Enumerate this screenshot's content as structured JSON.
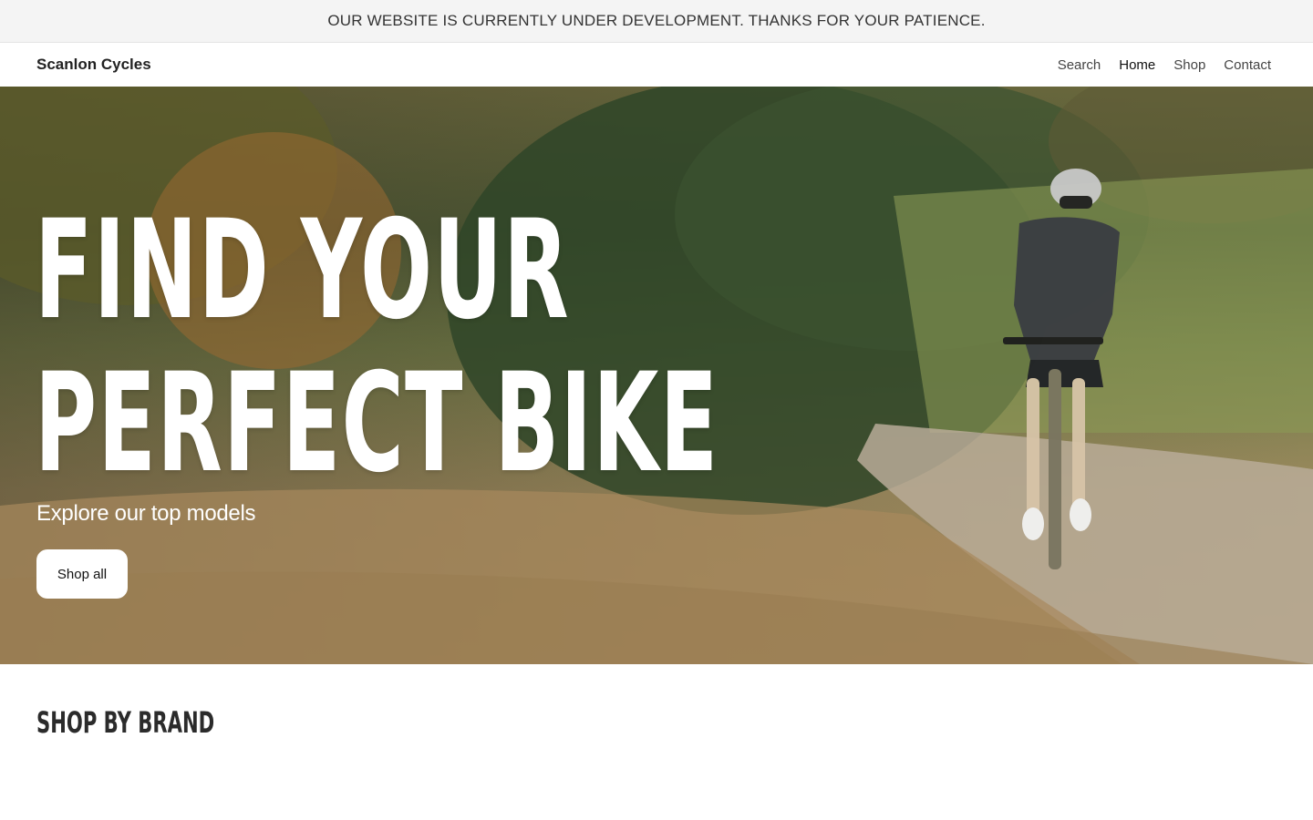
{
  "announcement": {
    "text": "OUR WEBSITE IS CURRENTLY UNDER DEVELOPMENT. THANKS FOR YOUR PATIENCE."
  },
  "header": {
    "brand": "Scanlon Cycles",
    "nav": {
      "search": "Search",
      "home": "Home",
      "shop": "Shop",
      "contact": "Contact"
    }
  },
  "hero": {
    "title_line1": "FIND YOUR",
    "title_line2": "PERFECT BIKE",
    "subtitle": "Explore our top models",
    "cta_label": "Shop all"
  },
  "sections": {
    "brands_title": "SHOP BY BRAND"
  },
  "colors": {
    "announcement_bg": "#f4f4f4",
    "hero_text": "#ffffff",
    "button_bg": "#ffffff"
  }
}
